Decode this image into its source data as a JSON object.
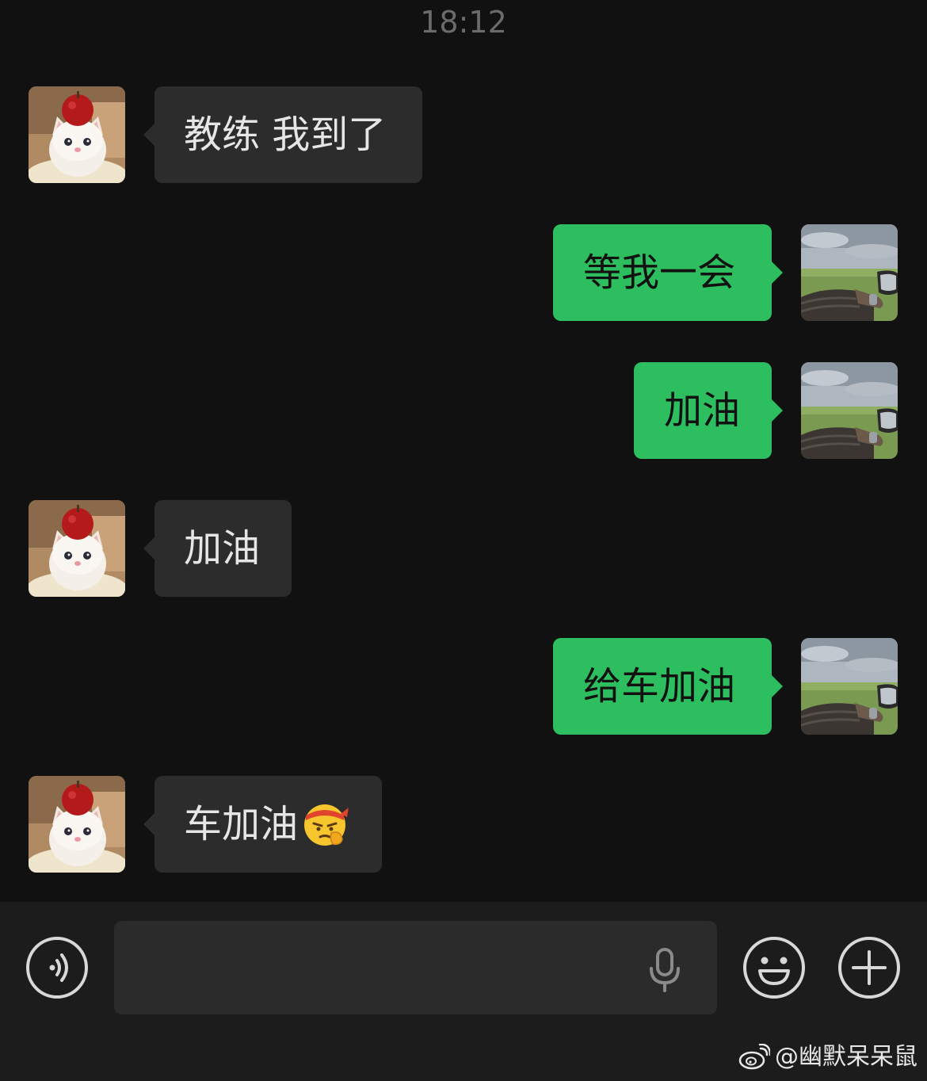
{
  "status": {
    "time": "18:12"
  },
  "messages": [
    {
      "side": "left",
      "text": "教练 我到了"
    },
    {
      "side": "right",
      "text": "等我一会"
    },
    {
      "side": "right",
      "text": "加油"
    },
    {
      "side": "left",
      "text": "加油"
    },
    {
      "side": "right",
      "text": "给车加油"
    },
    {
      "side": "left",
      "text": "车加油",
      "emoji": "determined-headband-face-emoji"
    }
  ],
  "avatars": {
    "contact": "kitten-with-apple-avatar",
    "self": "driving-car-window-avatar"
  },
  "input_bar": {
    "voice_icon": "voice-mode-icon",
    "mic_icon": "microphone-icon",
    "emoji_icon": "smiley-face-icon",
    "plus_icon": "plus-icon",
    "value": ""
  },
  "watermark": {
    "text": "@幽默呆呆鼠",
    "logo": "weibo-logo"
  },
  "colors": {
    "background": "#111111",
    "bubble_incoming": "#2c2c2c",
    "bubble_outgoing": "#2dbf5f",
    "input_bar": "#1c1c1c"
  }
}
